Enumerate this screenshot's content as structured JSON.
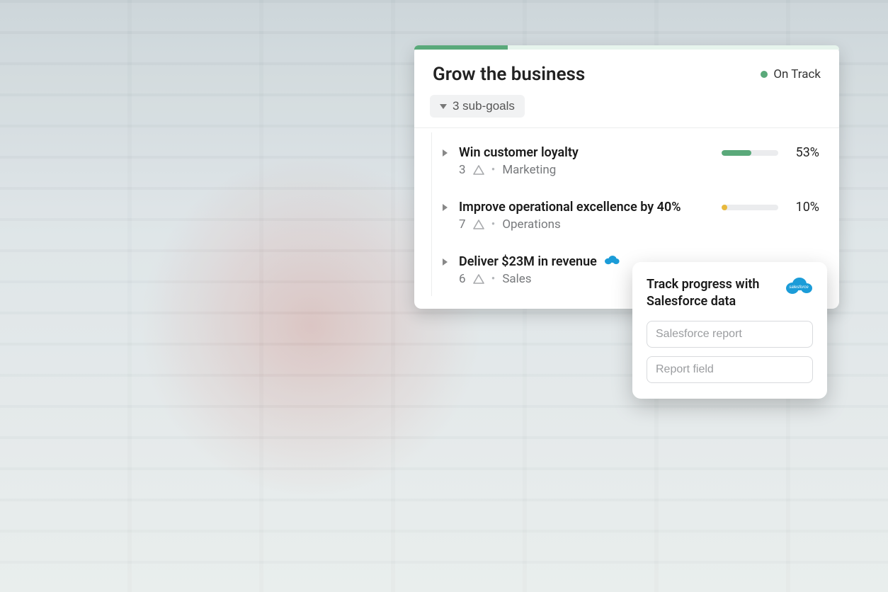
{
  "colors": {
    "green": "#5aa97a",
    "greenLight": "#e6f4ec",
    "yellow": "#e8b93d",
    "salesforce": "#1b9cd8"
  },
  "goalCard": {
    "title": "Grow the business",
    "progressPercent": 22,
    "status": {
      "label": "On Track"
    },
    "subGoalsPill": "3 sub-goals",
    "rows": [
      {
        "title": "Win customer loyalty",
        "count": "3",
        "team": "Marketing",
        "percent": "53%",
        "fill": 53,
        "barColor": "#5aa97a"
      },
      {
        "title": "Improve operational excellence by 40%",
        "count": "7",
        "team": "Operations",
        "percent": "10%",
        "fill": 10,
        "barColor": "#e8b93d"
      },
      {
        "title": "Deliver $23M in revenue",
        "count": "6",
        "team": "Sales",
        "percent": "",
        "fill": 0,
        "barColor": "#5aa97a",
        "hasSalesforceIcon": true
      }
    ]
  },
  "popover": {
    "title": "Track progress with Salesforce data",
    "fields": {
      "reportPlaceholder": "Salesforce report",
      "fieldPlaceholder": "Report field"
    }
  }
}
